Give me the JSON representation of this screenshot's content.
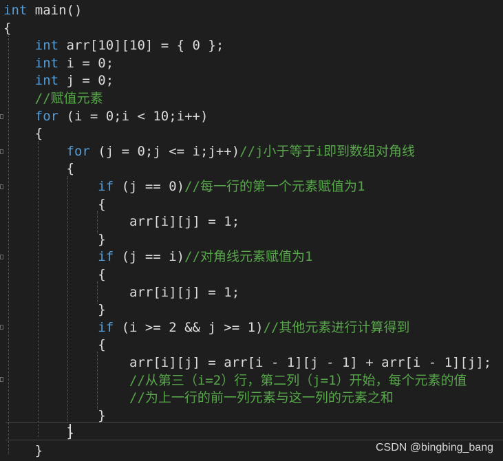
{
  "code_lines": [
    {
      "segments": [
        {
          "t": "int",
          "c": "kw"
        },
        {
          "t": " main()",
          "c": "id"
        }
      ]
    },
    {
      "segments": [
        {
          "t": "{",
          "c": "id"
        }
      ]
    },
    {
      "segments": [
        {
          "t": "    ",
          "c": "id"
        },
        {
          "t": "int",
          "c": "kw"
        },
        {
          "t": " arr[10][10] = { 0 };",
          "c": "id"
        }
      ]
    },
    {
      "segments": [
        {
          "t": "    ",
          "c": "id"
        },
        {
          "t": "int",
          "c": "kw"
        },
        {
          "t": " i = 0;",
          "c": "id"
        }
      ]
    },
    {
      "segments": [
        {
          "t": "    ",
          "c": "id"
        },
        {
          "t": "int",
          "c": "kw"
        },
        {
          "t": " j = 0;",
          "c": "id"
        }
      ]
    },
    {
      "segments": [
        {
          "t": "    ",
          "c": "id"
        },
        {
          "t": "//赋值元素",
          "c": "cm"
        }
      ]
    },
    {
      "segments": [
        {
          "t": "    ",
          "c": "id"
        },
        {
          "t": "for",
          "c": "kw"
        },
        {
          "t": " (i = 0;i < 10;i++)",
          "c": "id"
        }
      ]
    },
    {
      "segments": [
        {
          "t": "    {",
          "c": "id"
        }
      ]
    },
    {
      "segments": [
        {
          "t": "        ",
          "c": "id"
        },
        {
          "t": "for",
          "c": "kw"
        },
        {
          "t": " (j = 0;j <= i;j++)",
          "c": "id"
        },
        {
          "t": "//j小于等于i即到数组对角线",
          "c": "cm"
        }
      ]
    },
    {
      "segments": [
        {
          "t": "        {",
          "c": "id"
        }
      ]
    },
    {
      "segments": [
        {
          "t": "            ",
          "c": "id"
        },
        {
          "t": "if",
          "c": "kw"
        },
        {
          "t": " (j == 0)",
          "c": "id"
        },
        {
          "t": "//每一行的第一个元素赋值为1",
          "c": "cm"
        }
      ]
    },
    {
      "segments": [
        {
          "t": "            {",
          "c": "id"
        }
      ]
    },
    {
      "segments": [
        {
          "t": "                arr[i][j] = 1;",
          "c": "id"
        }
      ]
    },
    {
      "segments": [
        {
          "t": "            }",
          "c": "id"
        }
      ]
    },
    {
      "segments": [
        {
          "t": "            ",
          "c": "id"
        },
        {
          "t": "if",
          "c": "kw"
        },
        {
          "t": " (j == i)",
          "c": "id"
        },
        {
          "t": "//对角线元素赋值为1",
          "c": "cm"
        }
      ]
    },
    {
      "segments": [
        {
          "t": "            {",
          "c": "id"
        }
      ]
    },
    {
      "segments": [
        {
          "t": "                arr[i][j] = 1;",
          "c": "id"
        }
      ]
    },
    {
      "segments": [
        {
          "t": "            }",
          "c": "id"
        }
      ]
    },
    {
      "segments": [
        {
          "t": "            ",
          "c": "id"
        },
        {
          "t": "if",
          "c": "kw"
        },
        {
          "t": " (i >= 2 && j >= 1)",
          "c": "id"
        },
        {
          "t": "//其他元素进行计算得到",
          "c": "cm"
        }
      ]
    },
    {
      "segments": [
        {
          "t": "            {",
          "c": "id"
        }
      ]
    },
    {
      "segments": [
        {
          "t": "                arr[i][j] = arr[i - 1][j - 1] + arr[i - 1][j];",
          "c": "id"
        }
      ]
    },
    {
      "segments": [
        {
          "t": "                ",
          "c": "id"
        },
        {
          "t": "//从第三（i=2）行，第二列（j=1）开始，每个元素的值",
          "c": "cm"
        }
      ]
    },
    {
      "segments": [
        {
          "t": "                ",
          "c": "id"
        },
        {
          "t": "//为上一行的前一列元素与这一列的元素之和",
          "c": "cm"
        }
      ]
    },
    {
      "segments": [
        {
          "t": "            }",
          "c": "id"
        }
      ]
    },
    {
      "segments": [
        {
          "t": "        }",
          "c": "id"
        }
      ]
    },
    {
      "segments": [
        {
          "t": "    }",
          "c": "id"
        }
      ]
    }
  ],
  "watermark": "CSDN @bingbing_bang",
  "colors": {
    "background": "#1e1e1e",
    "keyword": "#569cd6",
    "comment": "#57a64a",
    "identifier": "#dcdcdc"
  }
}
